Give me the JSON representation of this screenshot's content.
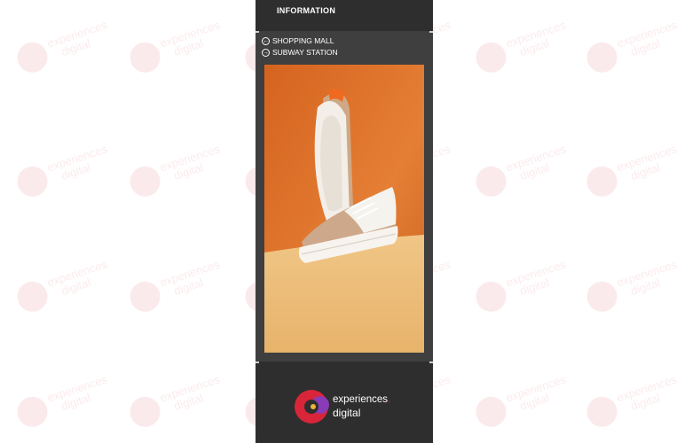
{
  "watermark": {
    "line1": "experiences",
    "line2": "digital"
  },
  "kiosk": {
    "header_title": "INFORMATION",
    "menu": [
      {
        "label": "SHOPPING MALL",
        "icon": "arrow-left-circle-icon"
      },
      {
        "label": "SUBWAY STATION",
        "icon": "arrow-right-circle-icon"
      }
    ],
    "colors": {
      "panel": "#3f3f3f",
      "bar": "#2e2e2e",
      "brand_red": "#d8253a",
      "brand_purple": "#8a3bb8",
      "orange_backdrop": "#e0782e",
      "floor": "#efc07f"
    }
  },
  "logo": {
    "line1": "experiences",
    "dot": ".",
    "line2": "digital"
  }
}
